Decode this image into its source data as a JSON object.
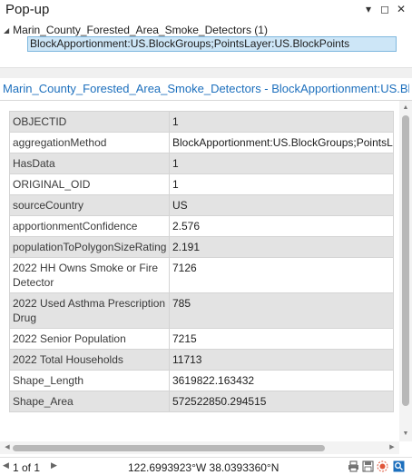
{
  "window": {
    "title": "Pop-up",
    "dropdown_glyph": "▾",
    "restore_glyph": "◻",
    "close_glyph": "✕"
  },
  "tree": {
    "layer_label": "Marin_County_Forested_Area_Smoke_Detectors (1)",
    "selected_feature": "BlockApportionment:US.BlockGroups;PointsLayer:US.BlockPoints"
  },
  "popup": {
    "header_title": "Marin_County_Forested_Area_Smoke_Detectors - BlockApportionment:US.BlockGroups;PointsLayer:US.BlockPoints",
    "rows": [
      {
        "field": "OBJECTID",
        "value": "1"
      },
      {
        "field": "aggregationMethod",
        "value": "BlockApportionment:US.BlockGroups;PointsLayer:US.BlockPoints"
      },
      {
        "field": "HasData",
        "value": "1"
      },
      {
        "field": "ORIGINAL_OID",
        "value": "1"
      },
      {
        "field": "sourceCountry",
        "value": "US"
      },
      {
        "field": "apportionmentConfidence",
        "value": "2.576"
      },
      {
        "field": "populationToPolygonSizeRating",
        "value": "2.191"
      },
      {
        "field": "2022 HH Owns Smoke or Fire Detector",
        "value": "7126"
      },
      {
        "field": "2022 Used Asthma Prescription Drug",
        "value": "785"
      },
      {
        "field": "2022 Senior Population",
        "value": "7215"
      },
      {
        "field": "2022 Total Households",
        "value": "11713"
      },
      {
        "field": "Shape_Length",
        "value": "3619822.163432"
      },
      {
        "field": "Shape_Area",
        "value": "572522850.294515"
      }
    ]
  },
  "status": {
    "pager": "1 of 1",
    "coordinates": "122.6993923°W 38.0393360°N"
  },
  "icons": [
    "chevron-down-icon",
    "restore-icon",
    "close-icon",
    "expand-triangle-icon",
    "prev-arrow-icon",
    "next-arrow-icon",
    "print-icon",
    "save-icon",
    "flash-icon",
    "zoom-to-icon"
  ]
}
